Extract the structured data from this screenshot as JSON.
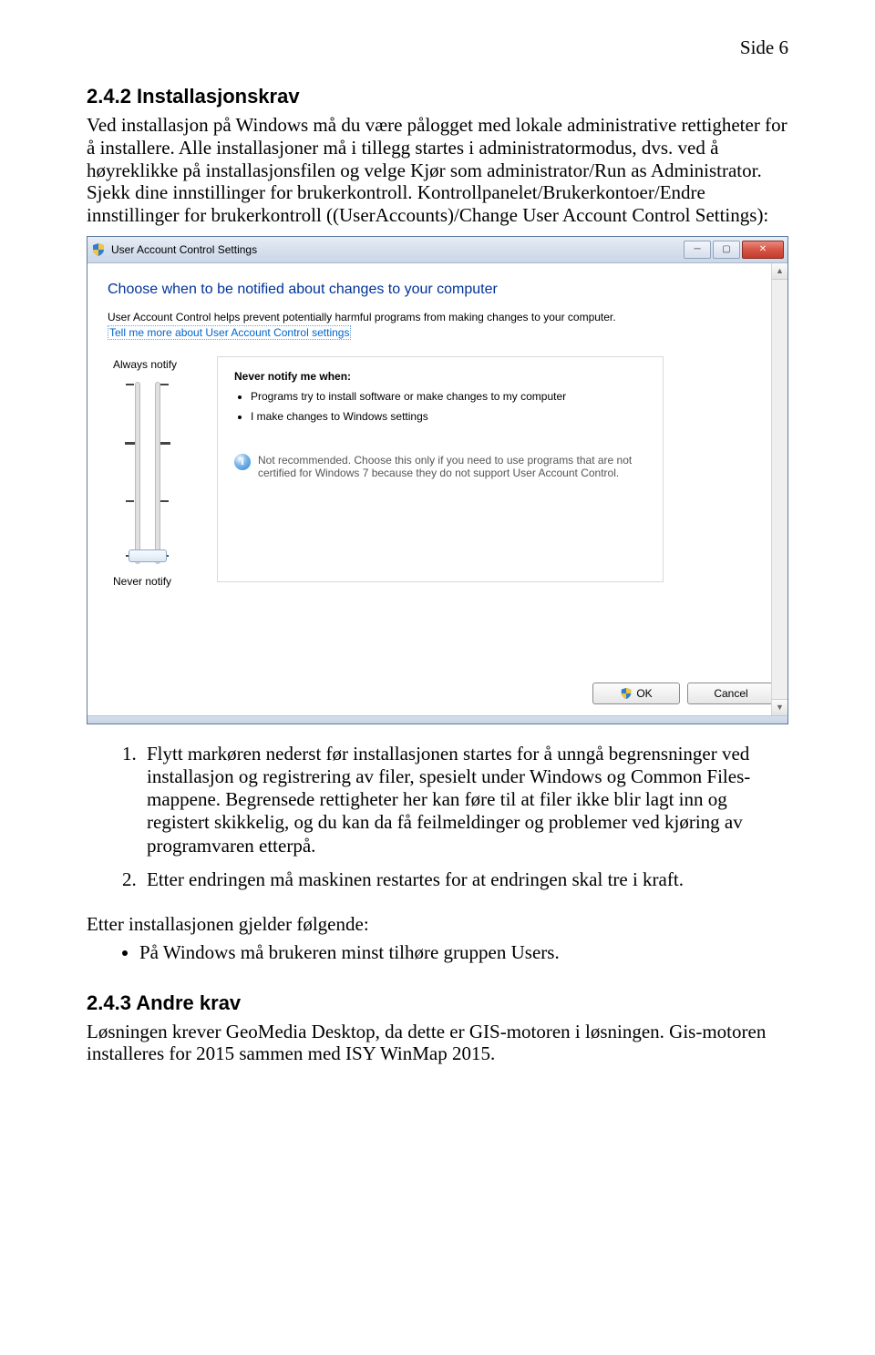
{
  "page": {
    "side_label": "Side 6"
  },
  "section1": {
    "heading": "2.4.2  Installasjonskrav",
    "para": "Ved installasjon på Windows må du være pålogget med lokale administrative rettigheter for å installere. Alle installasjoner må i tillegg startes i administratormodus, dvs. ved å høyreklikke på installasjonsfilen og velge Kjør som administrator/Run as Administrator. Sjekk dine innstillinger for brukerkontroll. Kontrollpanelet/Brukerkontoer/Endre innstillinger for brukerkontroll ((UserAccounts)/Change User Account Control Settings):"
  },
  "uac_window": {
    "title": "User Account Control Settings",
    "headline": "Choose when to be notified about changes to your computer",
    "desc": "User Account Control helps prevent potentially harmful programs from making changes to your computer.",
    "link": "Tell me more about User Account Control settings",
    "slider": {
      "top_label": "Always notify",
      "bottom_label": "Never notify"
    },
    "panel": {
      "title": "Never notify me when:",
      "items": [
        "Programs try to install software or make changes to my computer",
        "I make changes to Windows settings"
      ],
      "note": "Not recommended. Choose this only if you need to use programs that are not certified for Windows 7 because they do not support User Account Control."
    },
    "buttons": {
      "ok": "OK",
      "cancel": "Cancel"
    }
  },
  "list": {
    "item1": "Flytt markøren nederst før installasjonen startes for å unngå begrensninger ved installasjon og registrering av filer, spesielt under Windows og Common Files-mappene. Begrensede rettigheter her kan føre til at filer ikke blir lagt inn og registert skikkelig, og du kan da få feilmeldinger og problemer ved kjøring av programvaren etterpå.",
    "item2": "Etter endringen må maskinen restartes for at endringen skal tre i kraft."
  },
  "after": {
    "intro": "Etter installasjonen gjelder følgende:",
    "bullet1": "På Windows må brukeren minst tilhøre gruppen Users."
  },
  "section2": {
    "heading": "2.4.3  Andre krav",
    "para": "Løsningen krever GeoMedia Desktop, da dette er GIS-motoren i løsningen. Gis-motoren installeres for 2015 sammen med ISY WinMap 2015."
  }
}
